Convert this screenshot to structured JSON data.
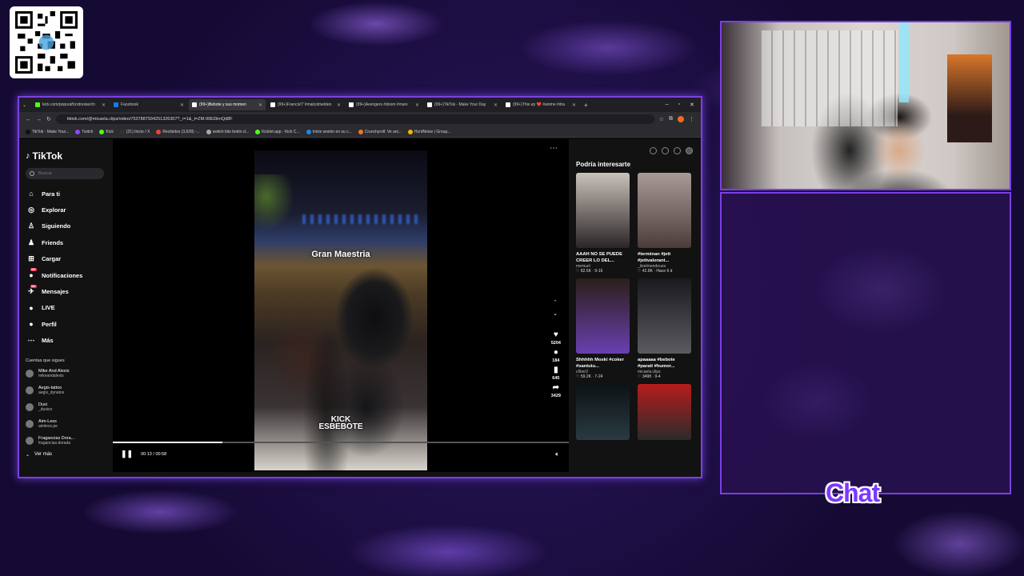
{
  "browser": {
    "tabs": [
      {
        "label": "kick.com/popout/hzrdnoise/ch",
        "color": "#53fc18",
        "active": false
      },
      {
        "label": "Facebook",
        "color": "#1877f2",
        "active": false
      },
      {
        "label": "(99+)Bebote y sus momen",
        "color": "#ffffff",
        "active": true
      },
      {
        "label": "(99+)Francis!7 #malcolmelden",
        "color": "#ffffff",
        "active": false
      },
      {
        "label": "(99+)Avengers #doom #marv",
        "color": "#ffffff",
        "active": false
      },
      {
        "label": "(99+)TikTok - Make Your Day",
        "color": "#ffffff",
        "active": false
      },
      {
        "label": "(99+)This ep ❤️ #anime #dra",
        "color": "#ffffff",
        "active": false
      }
    ],
    "url": "tiktok.com/@micaela.clips/video/7537887934251326307?_r=1&_t=ZM-90El3imQd8F",
    "bookmarks": [
      {
        "label": "TikTok - Make Your...",
        "color": "#111111"
      },
      {
        "label": "Twitch",
        "color": "#9146ff"
      },
      {
        "label": "Kick",
        "color": "#53fc18"
      },
      {
        "label": "(21) Inicio / X",
        "color": "#333333"
      },
      {
        "label": "Recibidos (3,628) -...",
        "color": "#ea4335"
      },
      {
        "label": "switch bits botón d...",
        "color": "#aaaaaa"
      },
      {
        "label": "Kicklet.app - Kick C...",
        "color": "#53fc18"
      },
      {
        "label": "Inicie sesión en su c...",
        "color": "#1e88e5"
      },
      {
        "label": "Crunchyroll: Ve ani...",
        "color": "#f47521"
      },
      {
        "label": "HzrdNoise | Group...",
        "color": "#f4b400"
      }
    ]
  },
  "tiktok": {
    "logo": "TikTok",
    "search_placeholder": "Buscar",
    "nav": [
      {
        "label": "Para ti",
        "icon": "home-icon",
        "glyph": "⌂"
      },
      {
        "label": "Explorar",
        "icon": "compass-icon",
        "glyph": "◎"
      },
      {
        "label": "Siguiendo",
        "icon": "following-icon",
        "glyph": "♙"
      },
      {
        "label": "Friends",
        "icon": "friends-icon",
        "glyph": "♟"
      },
      {
        "label": "Cargar",
        "icon": "upload-icon",
        "glyph": "⊞"
      },
      {
        "label": "Notificaciones",
        "icon": "bell-icon",
        "glyph": "●",
        "badge": "99+"
      },
      {
        "label": "Mensajes",
        "icon": "message-icon",
        "glyph": "✈",
        "badge": "99+"
      },
      {
        "label": "LIVE",
        "icon": "live-icon",
        "glyph": "●"
      },
      {
        "label": "Perfil",
        "icon": "profile-icon",
        "glyph": "●"
      },
      {
        "label": "Más",
        "icon": "more-icon",
        "glyph": "⋯"
      }
    ],
    "following_header": "Cuentas que sigues",
    "following": [
      {
        "name": "Mike And Alexis",
        "user": "mikeandalexis"
      },
      {
        "name": "Aegis-tattoo",
        "user": "aegis_dynatos"
      },
      {
        "name": "Dusi",
        "user": "_dusico"
      },
      {
        "name": "Aim-Less",
        "user": "aimless.pe"
      },
      {
        "name": "Fragancias Dora...",
        "user": "fragancias.dorada"
      }
    ],
    "ver_mas": "Ver más",
    "video": {
      "caption": "Gran Maestria",
      "watermark_line1": "KICK",
      "watermark_line2": "ESBEBOTE",
      "likes": "5204",
      "comments": "184",
      "saves": "645",
      "shares": "3429",
      "time": "00:13 / 00:58",
      "progress": 0.24
    },
    "recs_header": "Podría interesarte",
    "recs": [
      {
        "title": "AAAH NO SE PUEDE CREER LO DEL...",
        "author": "memuel",
        "stats": "♡ 82.5K · 9-16",
        "c1": "#c9c2bb",
        "c2": "#2b2526"
      },
      {
        "title": "#terminan #jett #jettvalorant...",
        "author": "_itzelmendouza",
        "stats": "♡ 42.8K · Hace 6 d",
        "c1": "#a99c98",
        "c2": "#4a3c38"
      },
      {
        "title": "Shhhhh Moski #coker #santutu...",
        "author": "c0ker2",
        "stats": "♡ 59.2K · 7-24",
        "c1": "#2a1f1a",
        "c2": "#6a3fb0"
      },
      {
        "title": "apaaaaa #bebote #parati #humor...",
        "author": "micaela.clips",
        "stats": "♡ 3498 · 9-4",
        "c1": "#1a1a1e",
        "c2": "#5a5a60"
      },
      {
        "title": "",
        "author": "",
        "stats": "",
        "c1": "#0d1215",
        "c2": "#2a3a42"
      },
      {
        "title": "",
        "author": "",
        "stats": "",
        "c1": "#b71c1c",
        "c2": "#2b2b2b"
      }
    ]
  },
  "overlay": {
    "chat_label": "Chat"
  }
}
